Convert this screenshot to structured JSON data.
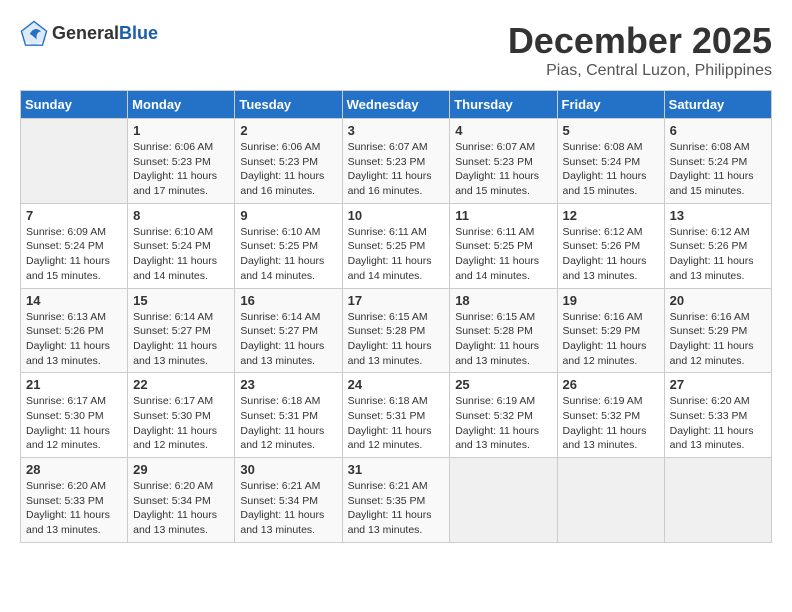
{
  "logo": {
    "text_general": "General",
    "text_blue": "Blue"
  },
  "header": {
    "month": "December 2025",
    "location": "Pias, Central Luzon, Philippines"
  },
  "weekdays": [
    "Sunday",
    "Monday",
    "Tuesday",
    "Wednesday",
    "Thursday",
    "Friday",
    "Saturday"
  ],
  "weeks": [
    [
      {
        "day": "",
        "sunrise": "",
        "sunset": "",
        "daylight": ""
      },
      {
        "day": "1",
        "sunrise": "Sunrise: 6:06 AM",
        "sunset": "Sunset: 5:23 PM",
        "daylight": "Daylight: 11 hours and 17 minutes."
      },
      {
        "day": "2",
        "sunrise": "Sunrise: 6:06 AM",
        "sunset": "Sunset: 5:23 PM",
        "daylight": "Daylight: 11 hours and 16 minutes."
      },
      {
        "day": "3",
        "sunrise": "Sunrise: 6:07 AM",
        "sunset": "Sunset: 5:23 PM",
        "daylight": "Daylight: 11 hours and 16 minutes."
      },
      {
        "day": "4",
        "sunrise": "Sunrise: 6:07 AM",
        "sunset": "Sunset: 5:23 PM",
        "daylight": "Daylight: 11 hours and 15 minutes."
      },
      {
        "day": "5",
        "sunrise": "Sunrise: 6:08 AM",
        "sunset": "Sunset: 5:24 PM",
        "daylight": "Daylight: 11 hours and 15 minutes."
      },
      {
        "day": "6",
        "sunrise": "Sunrise: 6:08 AM",
        "sunset": "Sunset: 5:24 PM",
        "daylight": "Daylight: 11 hours and 15 minutes."
      }
    ],
    [
      {
        "day": "7",
        "sunrise": "Sunrise: 6:09 AM",
        "sunset": "Sunset: 5:24 PM",
        "daylight": "Daylight: 11 hours and 15 minutes."
      },
      {
        "day": "8",
        "sunrise": "Sunrise: 6:10 AM",
        "sunset": "Sunset: 5:24 PM",
        "daylight": "Daylight: 11 hours and 14 minutes."
      },
      {
        "day": "9",
        "sunrise": "Sunrise: 6:10 AM",
        "sunset": "Sunset: 5:25 PM",
        "daylight": "Daylight: 11 hours and 14 minutes."
      },
      {
        "day": "10",
        "sunrise": "Sunrise: 6:11 AM",
        "sunset": "Sunset: 5:25 PM",
        "daylight": "Daylight: 11 hours and 14 minutes."
      },
      {
        "day": "11",
        "sunrise": "Sunrise: 6:11 AM",
        "sunset": "Sunset: 5:25 PM",
        "daylight": "Daylight: 11 hours and 14 minutes."
      },
      {
        "day": "12",
        "sunrise": "Sunrise: 6:12 AM",
        "sunset": "Sunset: 5:26 PM",
        "daylight": "Daylight: 11 hours and 13 minutes."
      },
      {
        "day": "13",
        "sunrise": "Sunrise: 6:12 AM",
        "sunset": "Sunset: 5:26 PM",
        "daylight": "Daylight: 11 hours and 13 minutes."
      }
    ],
    [
      {
        "day": "14",
        "sunrise": "Sunrise: 6:13 AM",
        "sunset": "Sunset: 5:26 PM",
        "daylight": "Daylight: 11 hours and 13 minutes."
      },
      {
        "day": "15",
        "sunrise": "Sunrise: 6:14 AM",
        "sunset": "Sunset: 5:27 PM",
        "daylight": "Daylight: 11 hours and 13 minutes."
      },
      {
        "day": "16",
        "sunrise": "Sunrise: 6:14 AM",
        "sunset": "Sunset: 5:27 PM",
        "daylight": "Daylight: 11 hours and 13 minutes."
      },
      {
        "day": "17",
        "sunrise": "Sunrise: 6:15 AM",
        "sunset": "Sunset: 5:28 PM",
        "daylight": "Daylight: 11 hours and 13 minutes."
      },
      {
        "day": "18",
        "sunrise": "Sunrise: 6:15 AM",
        "sunset": "Sunset: 5:28 PM",
        "daylight": "Daylight: 11 hours and 13 minutes."
      },
      {
        "day": "19",
        "sunrise": "Sunrise: 6:16 AM",
        "sunset": "Sunset: 5:29 PM",
        "daylight": "Daylight: 11 hours and 12 minutes."
      },
      {
        "day": "20",
        "sunrise": "Sunrise: 6:16 AM",
        "sunset": "Sunset: 5:29 PM",
        "daylight": "Daylight: 11 hours and 12 minutes."
      }
    ],
    [
      {
        "day": "21",
        "sunrise": "Sunrise: 6:17 AM",
        "sunset": "Sunset: 5:30 PM",
        "daylight": "Daylight: 11 hours and 12 minutes."
      },
      {
        "day": "22",
        "sunrise": "Sunrise: 6:17 AM",
        "sunset": "Sunset: 5:30 PM",
        "daylight": "Daylight: 11 hours and 12 minutes."
      },
      {
        "day": "23",
        "sunrise": "Sunrise: 6:18 AM",
        "sunset": "Sunset: 5:31 PM",
        "daylight": "Daylight: 11 hours and 12 minutes."
      },
      {
        "day": "24",
        "sunrise": "Sunrise: 6:18 AM",
        "sunset": "Sunset: 5:31 PM",
        "daylight": "Daylight: 11 hours and 12 minutes."
      },
      {
        "day": "25",
        "sunrise": "Sunrise: 6:19 AM",
        "sunset": "Sunset: 5:32 PM",
        "daylight": "Daylight: 11 hours and 13 minutes."
      },
      {
        "day": "26",
        "sunrise": "Sunrise: 6:19 AM",
        "sunset": "Sunset: 5:32 PM",
        "daylight": "Daylight: 11 hours and 13 minutes."
      },
      {
        "day": "27",
        "sunrise": "Sunrise: 6:20 AM",
        "sunset": "Sunset: 5:33 PM",
        "daylight": "Daylight: 11 hours and 13 minutes."
      }
    ],
    [
      {
        "day": "28",
        "sunrise": "Sunrise: 6:20 AM",
        "sunset": "Sunset: 5:33 PM",
        "daylight": "Daylight: 11 hours and 13 minutes."
      },
      {
        "day": "29",
        "sunrise": "Sunrise: 6:20 AM",
        "sunset": "Sunset: 5:34 PM",
        "daylight": "Daylight: 11 hours and 13 minutes."
      },
      {
        "day": "30",
        "sunrise": "Sunrise: 6:21 AM",
        "sunset": "Sunset: 5:34 PM",
        "daylight": "Daylight: 11 hours and 13 minutes."
      },
      {
        "day": "31",
        "sunrise": "Sunrise: 6:21 AM",
        "sunset": "Sunset: 5:35 PM",
        "daylight": "Daylight: 11 hours and 13 minutes."
      },
      {
        "day": "",
        "sunrise": "",
        "sunset": "",
        "daylight": ""
      },
      {
        "day": "",
        "sunrise": "",
        "sunset": "",
        "daylight": ""
      },
      {
        "day": "",
        "sunrise": "",
        "sunset": "",
        "daylight": ""
      }
    ]
  ]
}
